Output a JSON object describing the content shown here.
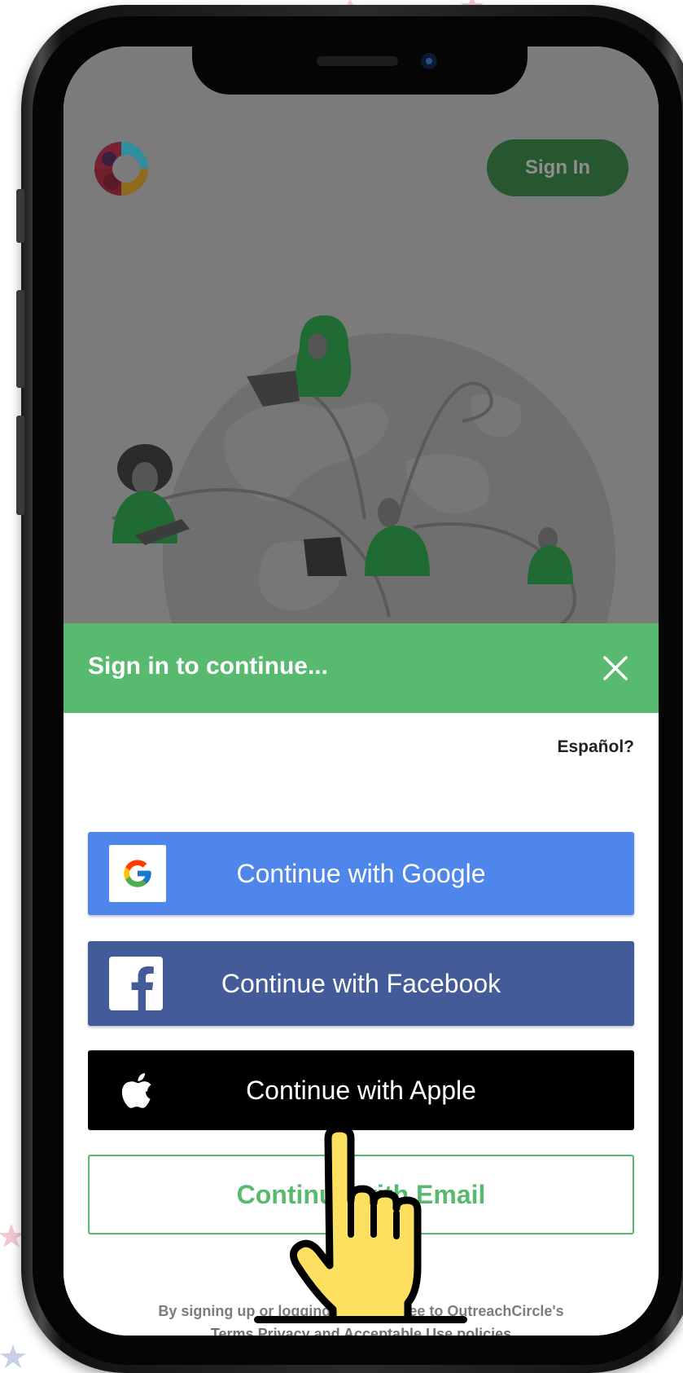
{
  "header": {
    "sign_in_label": "Sign In"
  },
  "sheet": {
    "title": "Sign in to continue...",
    "language_link": "Español?",
    "buttons": {
      "google": "Continue with Google",
      "facebook": "Continue with Facebook",
      "apple": "Continue with Apple",
      "email": "Continue with Email"
    },
    "terms": {
      "line1": "By signing up or logging in, you agree to OutreachCircle's",
      "terms_link": "Terms",
      "privacy_link": "Privacy",
      "and": "and",
      "acceptable_use_link": "Acceptable Use policies"
    }
  },
  "icons": [
    "logo-icon",
    "close-icon",
    "google-icon",
    "facebook-icon",
    "apple-icon",
    "pointing-hand-icon"
  ],
  "colors": {
    "brand_green": "#57ba6f",
    "dark_green": "#26572f",
    "google_blue": "#4f86ec",
    "facebook_blue": "#435b98",
    "overlay_gray": "#7b7b7b"
  }
}
